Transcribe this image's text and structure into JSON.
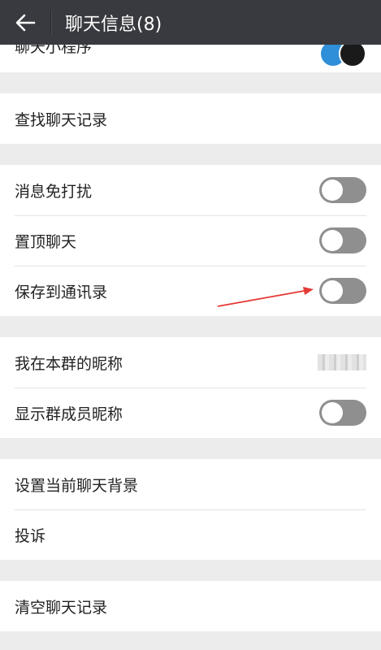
{
  "header": {
    "title": "聊天信息(8)"
  },
  "sections": {
    "mini_program": {
      "label": "聊天小程序"
    },
    "search": {
      "label": "查找聊天记录"
    },
    "mute": {
      "label": "消息免打扰",
      "enabled": false
    },
    "pin": {
      "label": "置顶聊天",
      "enabled": false
    },
    "save_contacts": {
      "label": "保存到通讯录",
      "enabled": false
    },
    "my_nickname": {
      "label": "我在本群的昵称"
    },
    "show_nicknames": {
      "label": "显示群成员昵称",
      "enabled": false
    },
    "background": {
      "label": "设置当前聊天背景"
    },
    "report": {
      "label": "投诉"
    },
    "clear": {
      "label": "清空聊天记录"
    }
  },
  "colors": {
    "header_bg": "#393a3f",
    "toggle_off": "#8f8f8f",
    "annotation_arrow": "#e53935"
  }
}
